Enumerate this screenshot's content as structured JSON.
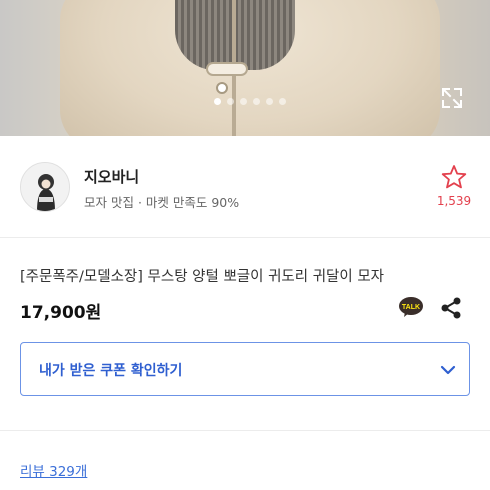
{
  "hero": {
    "slide_count": 6,
    "active_slide": 1,
    "expand_icon": "expand-icon"
  },
  "seller": {
    "name": "지오바니",
    "subtitle": "모자 맛집 · 마켓 만족도 90%",
    "heart_icon": "star-outline-icon",
    "heart_count": "1,539"
  },
  "product": {
    "title": "[주문폭주/모델소장] 무스탕 양털 뽀글이 귀도리 귀달이 모자",
    "price": "17,900원",
    "talk_icon": "kakaotalk-icon",
    "talk_label": "TALK",
    "share_icon": "share-icon"
  },
  "coupon": {
    "label": "내가 받은 쿠폰 확인하기",
    "icon": "chevron-down-icon"
  },
  "reviews": {
    "label": "리뷰 329개"
  },
  "colors": {
    "accent_blue": "#2f5fd0",
    "heart_red": "#e3404d",
    "link_blue": "#3b6fd8"
  }
}
